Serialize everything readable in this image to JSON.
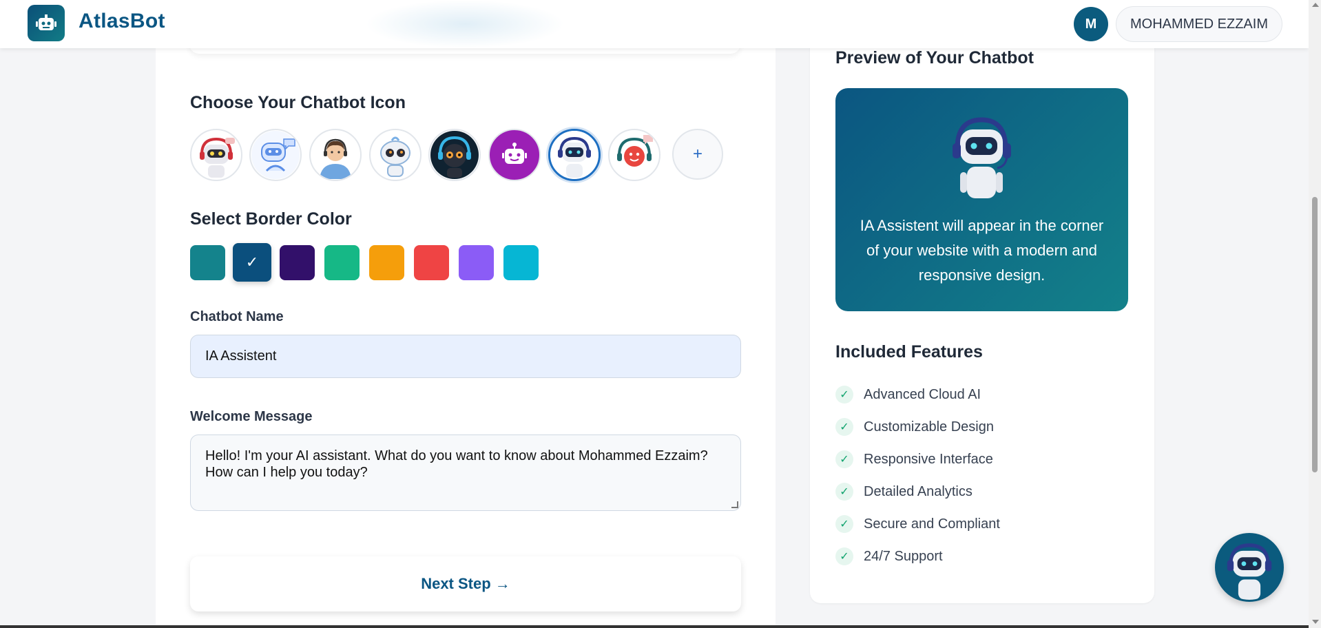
{
  "header": {
    "brand": "AtlasBot",
    "avatar_initial": "M",
    "user_name": "MOHAMMED EZZAIM"
  },
  "icon_section": {
    "title": "Choose Your Chatbot Icon",
    "add_label": "+",
    "icons": [
      "robot-headset-icon",
      "chat-bot-icon",
      "support-agent-icon",
      "cute-robot-icon",
      "dark-robot-icon",
      "purple-bot-icon",
      "blue-robot-icon",
      "smile-bot-icon"
    ],
    "selected_index": 6
  },
  "color_section": {
    "title": "Select Border Color",
    "colors": [
      "#14838c",
      "#0b4f7d",
      "#32106a",
      "#16b886",
      "#f59e0b",
      "#ef4444",
      "#8b5cf6",
      "#06b6d4"
    ],
    "selected_index": 1,
    "check_mark": "✓"
  },
  "name_field": {
    "label": "Chatbot Name",
    "value": "IA Assistent"
  },
  "welcome_field": {
    "label": "Welcome Message",
    "value": "Hello! I'm your AI assistant. What do you want to know about Mohammed Ezzaim? How can I help you today?"
  },
  "next_button": "Next Step →",
  "preview": {
    "title": "Preview of Your Chatbot",
    "text": "IA Assistent will appear in the corner of your website with a modern and responsive design."
  },
  "features": {
    "title": "Included Features",
    "items": [
      "Advanced Cloud AI",
      "Customizable Design",
      "Responsive Interface",
      "Detailed Analytics",
      "Secure and Compliant",
      "24/7 Support"
    ],
    "check": "✓"
  }
}
